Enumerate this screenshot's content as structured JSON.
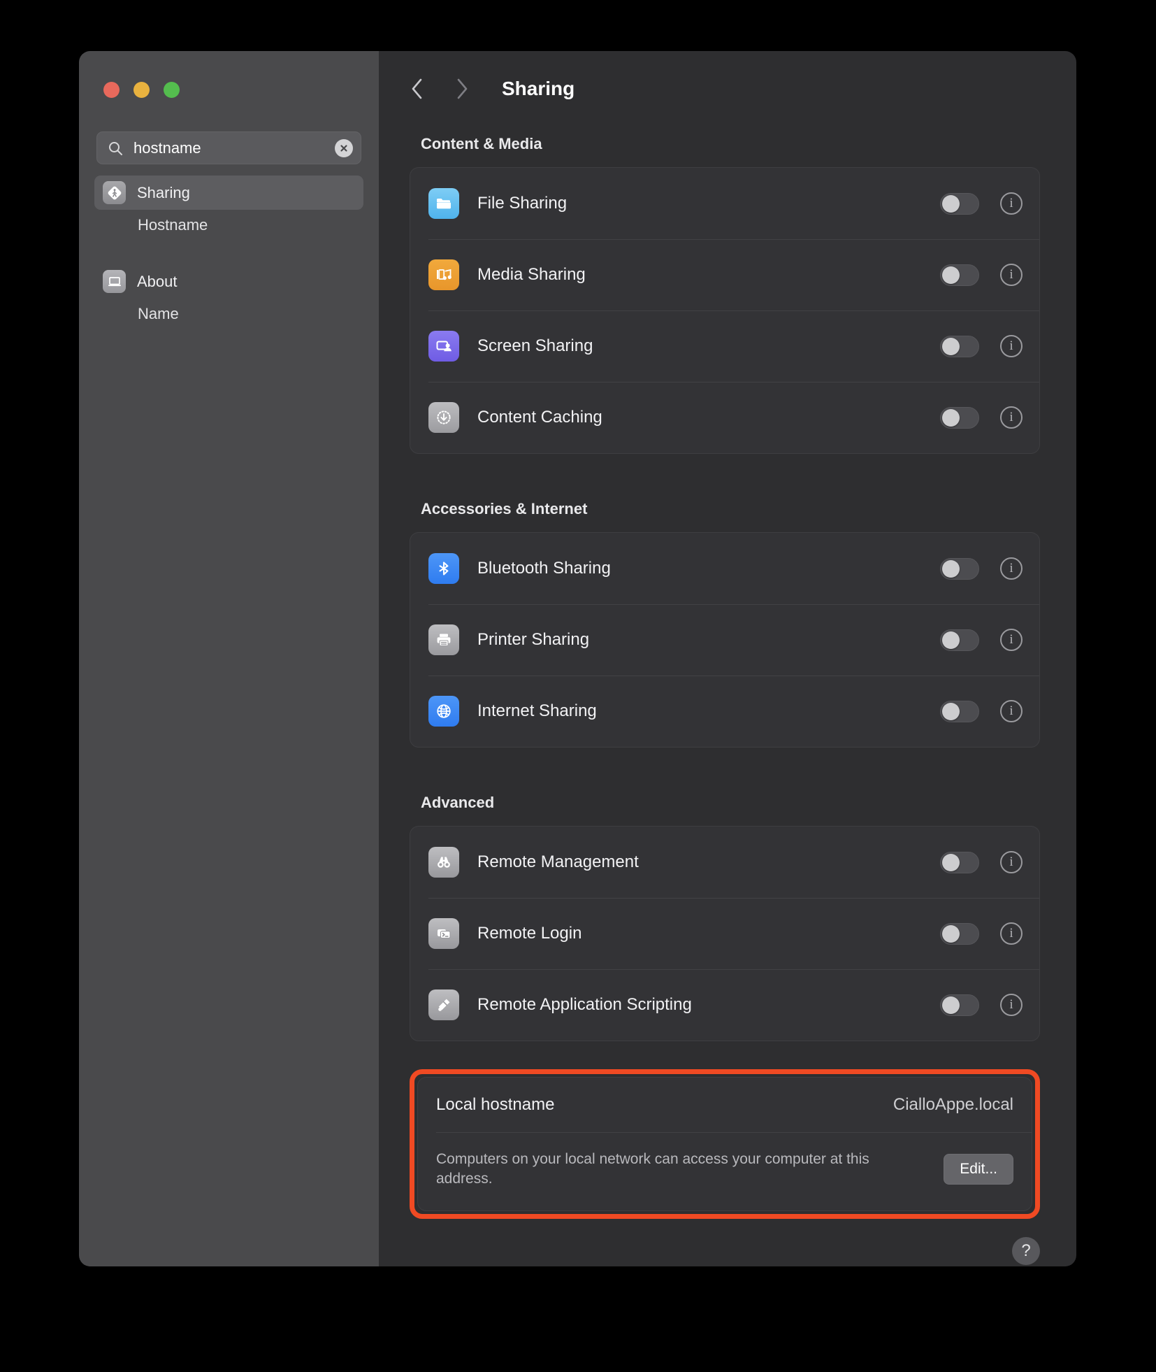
{
  "window": {
    "traffic_lights": [
      "close",
      "minimize",
      "zoom"
    ],
    "colors": {
      "close": "#e8695c",
      "minimize": "#e9b23f",
      "zoom": "#54bd4e",
      "highlight": "#f04a23"
    }
  },
  "sidebar": {
    "search": {
      "value": "hostname",
      "placeholder": "Search",
      "icon": "search-icon",
      "clear_icon": "clear-icon"
    },
    "items": [
      {
        "label": "Sharing",
        "icon": "sharing-icon",
        "selected": true,
        "type": "top"
      },
      {
        "label": "Hostname",
        "icon": "",
        "selected": false,
        "type": "sub"
      },
      {
        "label": "About",
        "icon": "about-icon",
        "selected": false,
        "type": "top"
      },
      {
        "label": "Name",
        "icon": "",
        "selected": false,
        "type": "sub"
      }
    ]
  },
  "header": {
    "back_icon": "chevron-left-icon",
    "forward_icon": "chevron-right-icon",
    "title": "Sharing"
  },
  "sections": [
    {
      "title": "Content & Media",
      "rows": [
        {
          "label": "File Sharing",
          "icon": "folder-icon",
          "enabled": false,
          "info": "i"
        },
        {
          "label": "Media Sharing",
          "icon": "media-icon",
          "enabled": false,
          "info": "i"
        },
        {
          "label": "Screen Sharing",
          "icon": "screen-icon",
          "enabled": false,
          "info": "i"
        },
        {
          "label": "Content Caching",
          "icon": "download-icon",
          "enabled": false,
          "info": "i"
        }
      ]
    },
    {
      "title": "Accessories & Internet",
      "rows": [
        {
          "label": "Bluetooth Sharing",
          "icon": "bluetooth-icon",
          "enabled": false,
          "info": "i"
        },
        {
          "label": "Printer Sharing",
          "icon": "printer-icon",
          "enabled": false,
          "info": "i"
        },
        {
          "label": "Internet Sharing",
          "icon": "globe-icon",
          "enabled": false,
          "info": "i"
        }
      ]
    },
    {
      "title": "Advanced",
      "rows": [
        {
          "label": "Remote Management",
          "icon": "binoculars-icon",
          "enabled": false,
          "info": "i"
        },
        {
          "label": "Remote Login",
          "icon": "terminal-icon",
          "enabled": false,
          "info": "i"
        },
        {
          "label": "Remote Application Scripting",
          "icon": "script-icon",
          "enabled": false,
          "info": "i"
        }
      ]
    }
  ],
  "hostname_card": {
    "label": "Local hostname",
    "value": "CialloAppe.local",
    "description": "Computers on your local network can access your computer at this address.",
    "edit_label": "Edit..."
  },
  "help": {
    "label": "?",
    "icon": "help-icon"
  }
}
